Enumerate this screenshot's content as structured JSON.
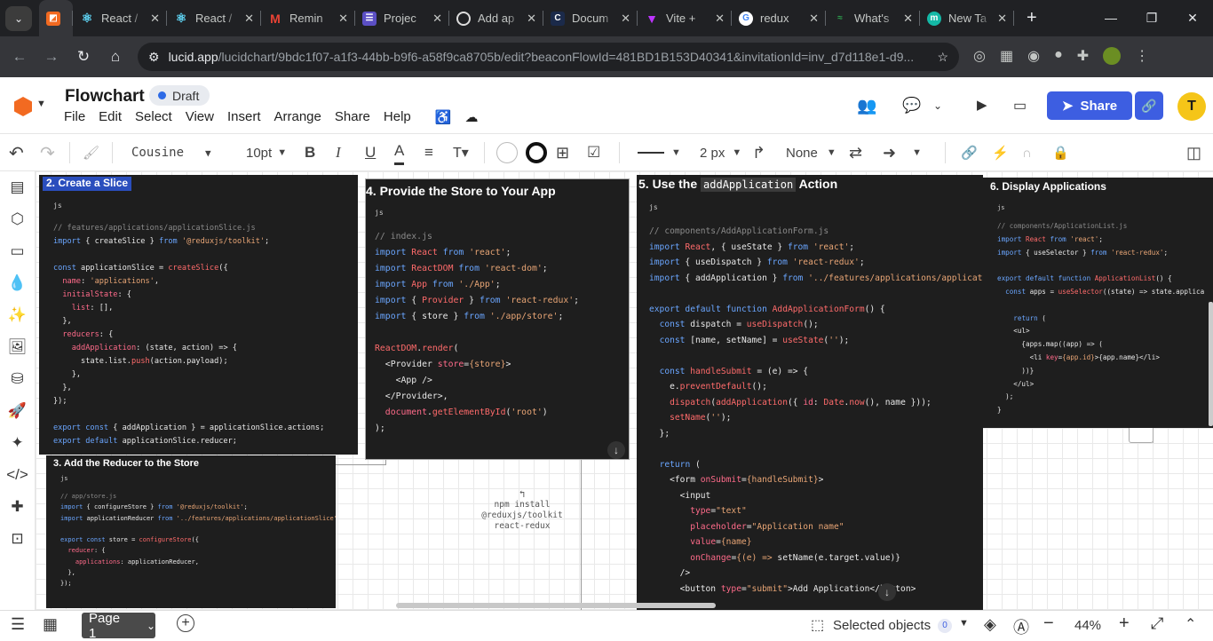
{
  "browser": {
    "tabs": [
      {
        "title": "",
        "favicon": "lucid-icon",
        "active": true
      },
      {
        "title": "React /",
        "favicon": "react-icon"
      },
      {
        "title": "React /",
        "favicon": "react-icon"
      },
      {
        "title": "Remin",
        "favicon": "gmail-icon"
      },
      {
        "title": "Projec",
        "favicon": "projects-icon"
      },
      {
        "title": "Add ap",
        "favicon": "openai-icon"
      },
      {
        "title": "Docum",
        "favicon": "docs-icon"
      },
      {
        "title": "Vite +",
        "favicon": "vite-icon"
      },
      {
        "title": "redux",
        "favicon": "google-icon"
      },
      {
        "title": "What's",
        "favicon": "whats-icon"
      },
      {
        "title": "New Ta",
        "favicon": "newtab-icon"
      }
    ],
    "url_site": "lucid.app",
    "url_rest": "/lucidchart/9bdc1f07-a1f3-44bb-b9f6-a58f9ca8705b/edit?beaconFlowId=481BD1B153D40341&invitationId=inv_d7d118e1-d9..."
  },
  "app": {
    "title": "Flowchart",
    "status": "Draft",
    "menus": [
      "File",
      "Edit",
      "Select",
      "View",
      "Insert",
      "Arrange",
      "Share",
      "Help"
    ],
    "share_label": "Share",
    "avatar_initial": "T",
    "brand_color": "#3d5ee1"
  },
  "toolbar": {
    "font": "Cousine",
    "font_size": "10pt",
    "line_width": "2 px",
    "line_end": "None"
  },
  "cards": {
    "c2": {
      "title": "2. Create a Slice",
      "lang": "js"
    },
    "c3": {
      "title": "3. Add the Reducer to the Store",
      "lang": "js"
    },
    "c4": {
      "title": "4. Provide the Store to Your App",
      "lang": "js"
    },
    "c5": {
      "title_pre": "5. Use the",
      "title_code": "addApplication",
      "title_post": "Action",
      "lang": "js"
    },
    "c6": {
      "title": "6. Display Applications",
      "lang": "js"
    }
  },
  "canvas_note": {
    "line1": "npm install",
    "line2": "@reduxjs/toolkit",
    "line3": "react-redux"
  },
  "bottom": {
    "page_label": "Page 1",
    "selected_label": "Selected objects",
    "selected_count": "0",
    "zoom": "44%"
  }
}
